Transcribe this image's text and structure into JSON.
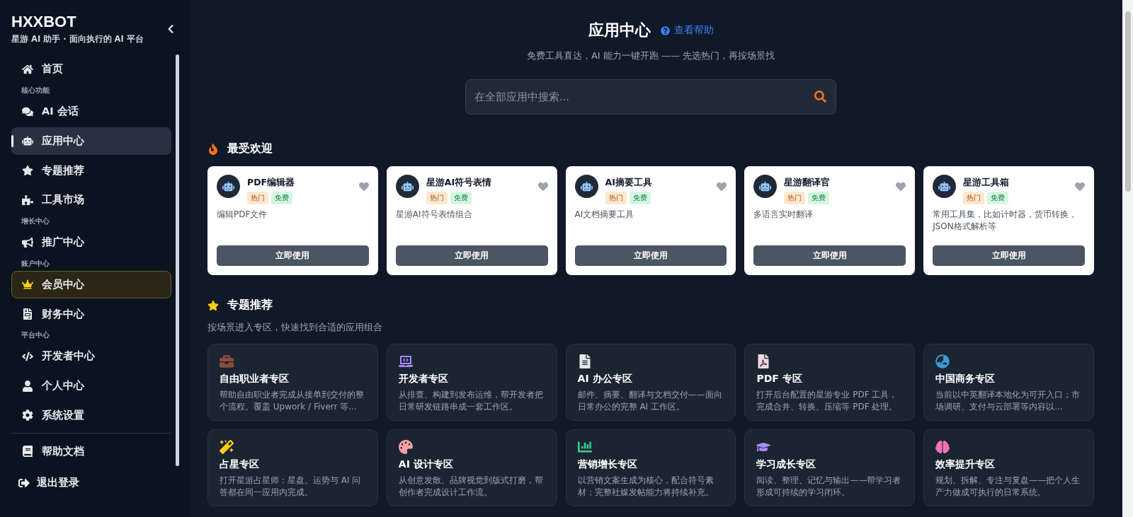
{
  "sidebar": {
    "brand": "HXXBOT",
    "tagline": "星游 AI 助手 · 面向执行的 AI 平台",
    "items": [
      {
        "kind": "link",
        "label": "首页",
        "selected": false
      },
      {
        "kind": "section",
        "label": "核心功能"
      },
      {
        "kind": "link",
        "label": "AI 会话",
        "selected": false
      },
      {
        "kind": "link",
        "label": "应用中心",
        "selected": true
      },
      {
        "kind": "link",
        "label": "专题推荐",
        "selected": false
      },
      {
        "kind": "link",
        "label": "工具市场",
        "selected": false
      },
      {
        "kind": "section",
        "label": "增长中心"
      },
      {
        "kind": "link",
        "label": "推广中心",
        "selected": false
      },
      {
        "kind": "section",
        "label": "账户中心"
      },
      {
        "kind": "vip",
        "label": "会员中心",
        "selected": false
      },
      {
        "kind": "link",
        "label": "财务中心",
        "selected": false
      },
      {
        "kind": "section",
        "label": "平台中心"
      },
      {
        "kind": "link",
        "label": "开发者中心",
        "selected": false
      },
      {
        "kind": "link",
        "label": "个人中心",
        "selected": false
      },
      {
        "kind": "link",
        "label": "系统设置",
        "selected": false
      },
      {
        "kind": "divider"
      },
      {
        "kind": "link",
        "label": "帮助文档",
        "selected": false
      }
    ],
    "logout": "退出登录"
  },
  "header": {
    "title": "应用中心",
    "help_link": "查看帮助",
    "subtitle": "免费工具直达，AI 能力一键开跑 —— 先选热门，再按场景找"
  },
  "search": {
    "placeholder": "在全部应用中搜索..."
  },
  "popular": {
    "title": "最受欢迎",
    "apps": [
      {
        "name": "PDF编辑器",
        "tags": [
          {
            "kind": "hot",
            "label": "热门"
          },
          {
            "kind": "free",
            "label": "免费"
          }
        ],
        "description": "编辑PDF文件",
        "button": "立即使用",
        "favorited": false
      },
      {
        "name": "星游AI符号表情",
        "tags": [
          {
            "kind": "hot",
            "label": "热门"
          },
          {
            "kind": "free",
            "label": "免费"
          }
        ],
        "description": "星游AI符号表情组合",
        "button": "立即使用",
        "favorited": false
      },
      {
        "name": "AI摘要工具",
        "tags": [
          {
            "kind": "hot",
            "label": "热门"
          },
          {
            "kind": "free",
            "label": "免费"
          }
        ],
        "description": "AI文档摘要工具",
        "button": "立即使用",
        "favorited": false
      },
      {
        "name": "星游翻译官",
        "tags": [
          {
            "kind": "hot",
            "label": "热门"
          },
          {
            "kind": "free",
            "label": "免费"
          }
        ],
        "description": "多语言实时翻译",
        "button": "立即使用",
        "favorited": false
      },
      {
        "name": "星游工具箱",
        "tags": [
          {
            "kind": "hot",
            "label": "热门"
          },
          {
            "kind": "free",
            "label": "免费"
          }
        ],
        "description": "常用工具集，比如计时器，货币转换，JSON格式解析等",
        "button": "立即使用",
        "favorited": false
      }
    ]
  },
  "topics": {
    "title": "专题推荐",
    "subtitle": "按场景进入专区，快速找到合适的应用组合",
    "items": [
      {
        "title": "自由职业者专区",
        "description": "帮助自由职业者完成从接单到交付的整个流程。覆盖 Upwork / Fiverr 等..."
      },
      {
        "title": "开发者专区",
        "description": "从排查、构建到发布运维，帮开发者把日常研发链路串成一套工作区。"
      },
      {
        "title": "AI 办公专区",
        "description": "邮件、摘要、翻译与文档交付——面向日常办公的完整 AI 工作区。"
      },
      {
        "title": "PDF 专区",
        "description": "打开后台配置的星游专业 PDF 工具，完成合并、转换、压缩等 PDF 处理。"
      },
      {
        "title": "中国商务专区",
        "description": "当前以中英翻译本地化为可开入口；市场调研、支付与云部署等内容以..."
      },
      {
        "title": "占星专区",
        "description": "打开星游占星师：星盘、运势与 AI 问答都在同一应用内完成。"
      },
      {
        "title": "AI 设计专区",
        "description": "从创意发散、品牌视觉到版式打磨，帮创作者完成设计工作流。"
      },
      {
        "title": "营销增长专区",
        "description": "以营销文案生成为核心，配合符号素材；完整社媒发帖能力将持续补充。"
      },
      {
        "title": "学习成长专区",
        "description": "阅读、整理、记忆与输出——帮学习者形成可持续的学习闭环。"
      },
      {
        "title": "效率提升专区",
        "description": "规划、拆解、专注与复盘——把个人生产力做成可执行的日常系统。"
      }
    ]
  }
}
